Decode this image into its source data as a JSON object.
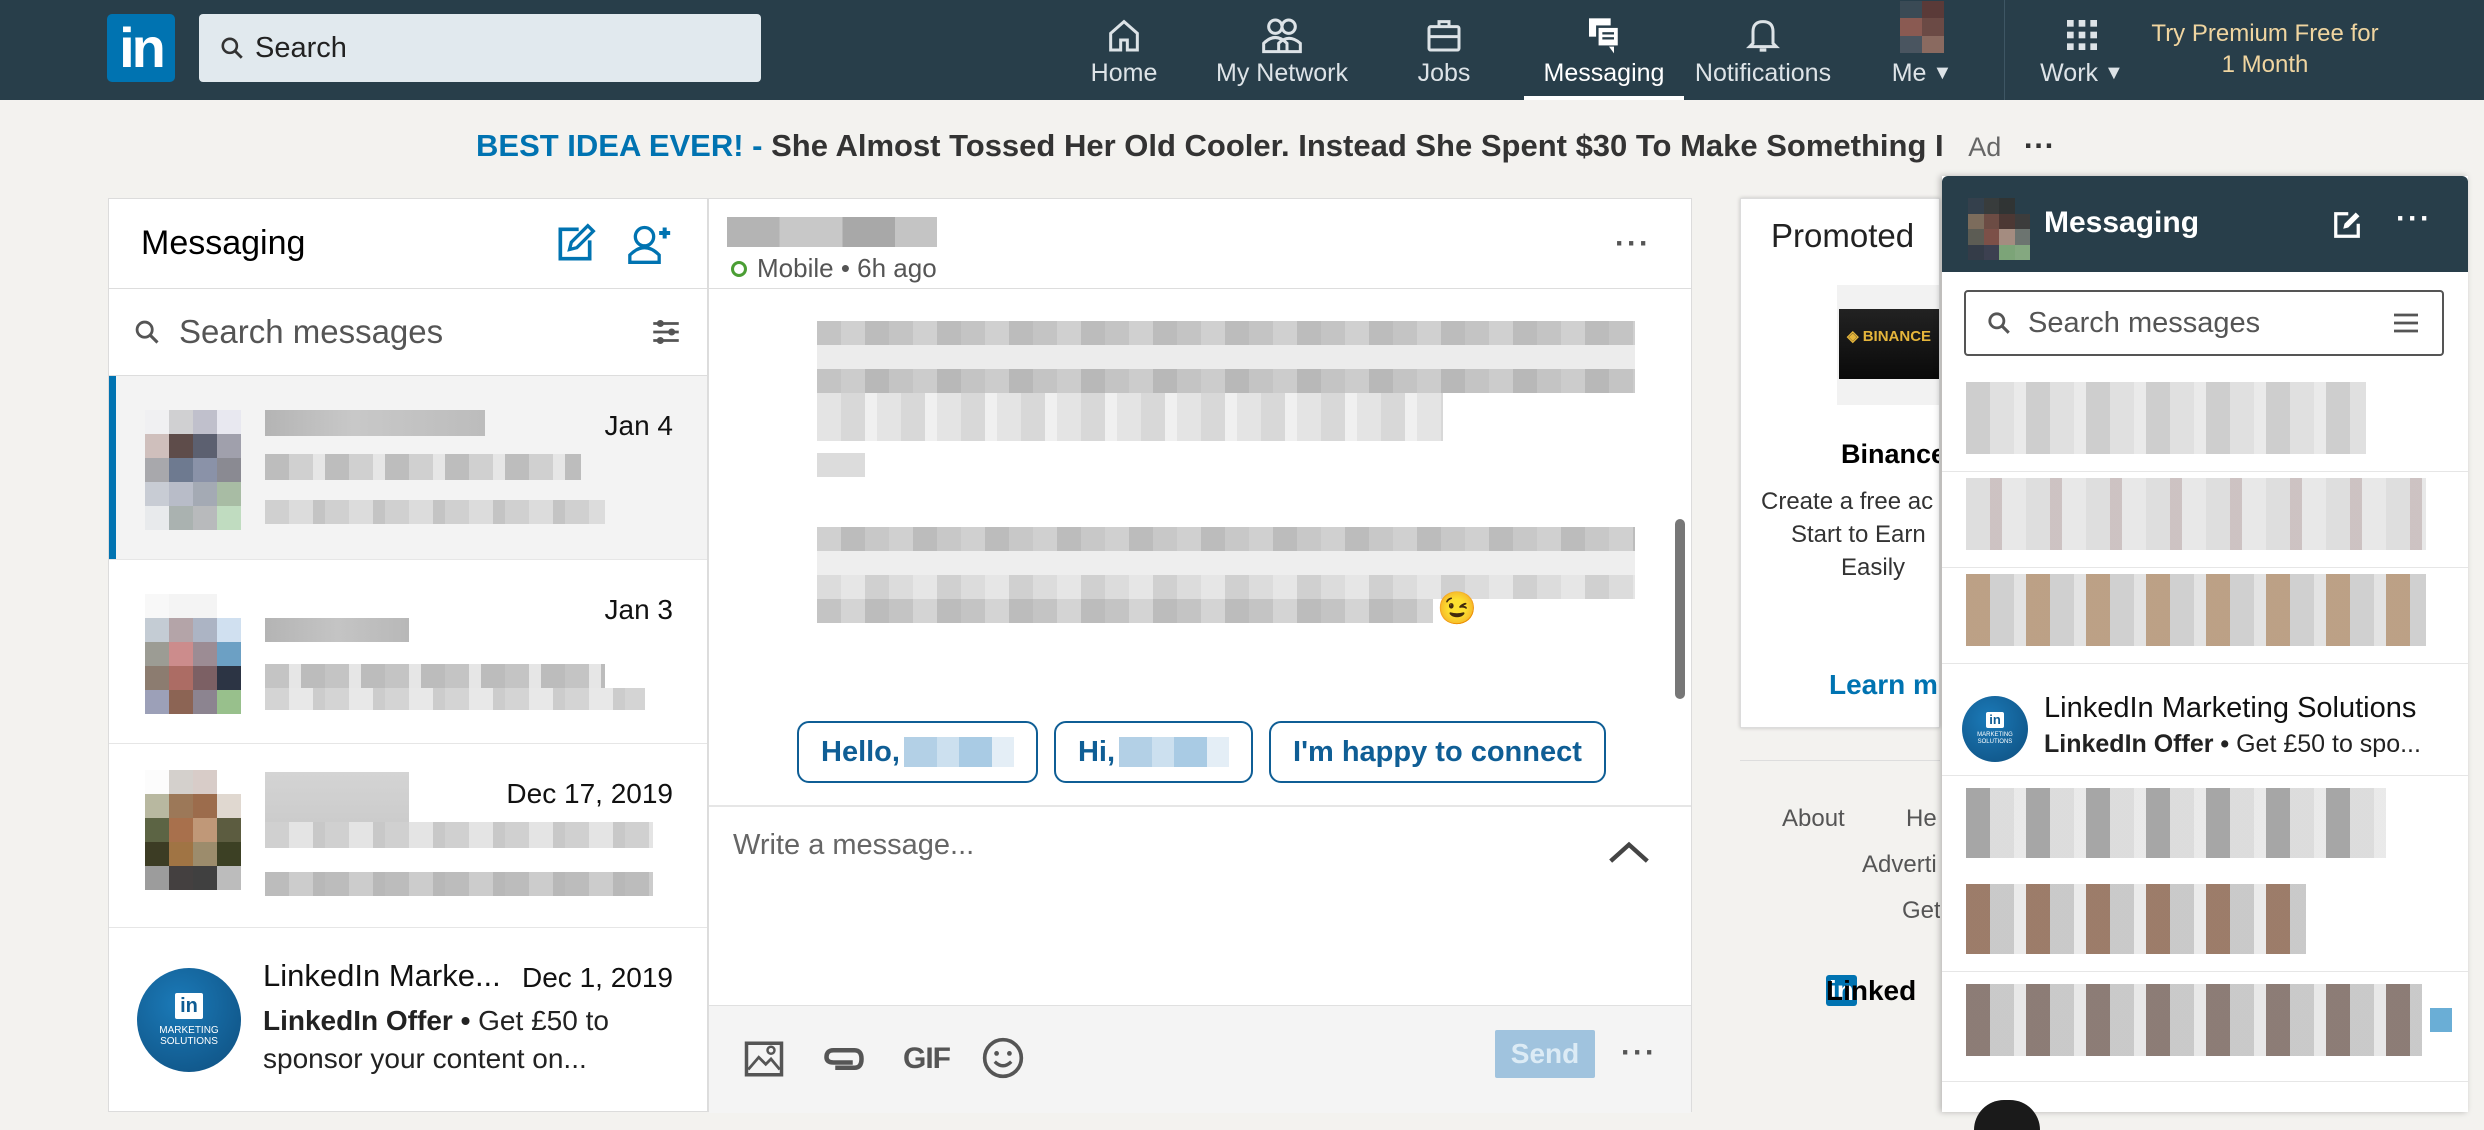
{
  "topbar": {
    "logo": "in",
    "search_placeholder": "Search",
    "nav": [
      {
        "label": "Home",
        "icon": "home-icon"
      },
      {
        "label": "My Network",
        "icon": "network-icon"
      },
      {
        "label": "Jobs",
        "icon": "briefcase-icon"
      },
      {
        "label": "Messaging",
        "icon": "messaging-icon",
        "active": true
      },
      {
        "label": "Notifications",
        "icon": "bell-icon"
      },
      {
        "label": "Me",
        "icon": "avatar"
      },
      {
        "label": "Work",
        "icon": "grid-icon"
      }
    ],
    "premium": "Try Premium Free for 1 Month"
  },
  "ad": {
    "highlight": "BEST IDEA EVER! -",
    "text": "She Almost Tossed Her Old Cooler. Instead She Spent $30 To Make Something I",
    "label": "Ad",
    "more": "···"
  },
  "left_panel": {
    "title": "Messaging",
    "search_placeholder": "Search messages",
    "conversations": [
      {
        "date": "Jan 4",
        "selected": true
      },
      {
        "date": "Jan 3"
      },
      {
        "date": "Dec 17, 2019"
      },
      {
        "name": "LinkedIn Marke...",
        "date": "Dec 1, 2019",
        "sender": "LinkedIn Offer •",
        "preview": "Get £50 to sponsor your content on..."
      }
    ],
    "avatar_text": {
      "in": "in",
      "line1": "MARKETING",
      "line2": "SOLUTIONS"
    }
  },
  "conversation": {
    "status": "Mobile • 6h ago",
    "more": "···",
    "emoji": "😉",
    "quick_replies": [
      "Hello,",
      "Hi,",
      "I'm happy to connect"
    ],
    "compose_placeholder": "Write a message...",
    "send_label": "Send",
    "toolbar_more": "···",
    "gif_label": "GIF"
  },
  "promoted": {
    "title": "Promoted",
    "brand_image_text": "◈ BINANCE",
    "name": "Binance",
    "description_lines": [
      "Create a free ac",
      "Start to Earn",
      "Easily"
    ],
    "cta": "Learn mo"
  },
  "footer": {
    "links": [
      "About",
      "He",
      "Adverti",
      "Get"
    ],
    "brand": "Linked",
    "brand_in": "in"
  },
  "dock": {
    "title": "Messaging",
    "search_placeholder": "Search messages",
    "featured": {
      "name": "LinkedIn Marketing Solutions",
      "sender": "LinkedIn Offer •",
      "preview": "Get £50 to spo..."
    }
  },
  "colors": {
    "brand": "#0073b1",
    "topbar": "#283e4a",
    "online": "#4b9e34"
  }
}
